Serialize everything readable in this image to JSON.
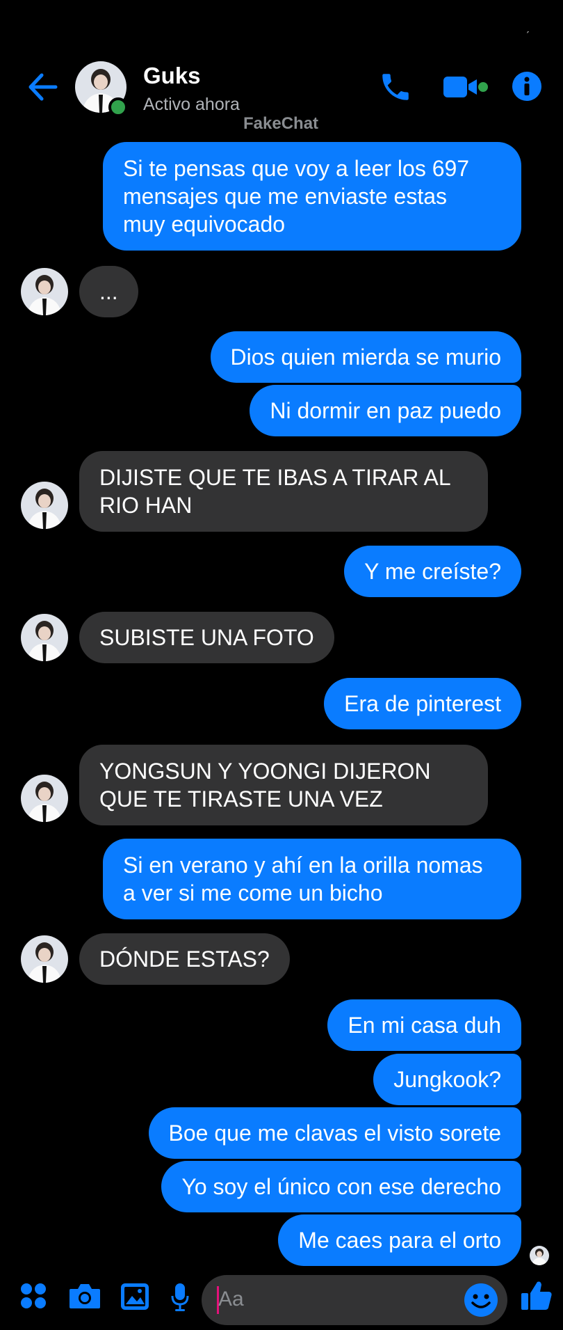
{
  "status_bar": {
    "mark": "ˏ"
  },
  "header": {
    "name": "Guks",
    "status": "Activo ahora",
    "watermark": "FakeChat",
    "accent": "#0a7cff",
    "online_color": "#31a24c"
  },
  "messages": [
    {
      "from": "me",
      "text": "Si te pensas que voy a leer los 697\nmensajes que me enviaste estas\nmuy equivocado"
    },
    {
      "from": "them",
      "text": "..."
    },
    {
      "from": "me",
      "text": "Dios quien mierda se murio"
    },
    {
      "from": "me",
      "text": "Ni dormir en paz puedo"
    },
    {
      "from": "them",
      "text": "DIJISTE QUE TE IBAS A TIRAR AL\nRIO HAN"
    },
    {
      "from": "me",
      "text": "Y me creíste?"
    },
    {
      "from": "them",
      "text": "SUBISTE UNA FOTO"
    },
    {
      "from": "me",
      "text": "Era de pinterest"
    },
    {
      "from": "them",
      "text": "YONGSUN Y YOONGI DIJERON\nQUE TE TIRASTE UNA VEZ"
    },
    {
      "from": "me",
      "text": "Si en verano y ahí en la orilla nomas\na ver si me come un bicho"
    },
    {
      "from": "them",
      "text": "DÓNDE ESTAS?"
    },
    {
      "from": "me",
      "text": "En mi casa duh"
    },
    {
      "from": "me",
      "text": "Jungkook?"
    },
    {
      "from": "me",
      "text": "Boe que me clavas el visto sorete"
    },
    {
      "from": "me",
      "text": "Yo soy el único con ese derecho"
    },
    {
      "from": "me",
      "text": "Me caes para el orto"
    }
  ],
  "composer": {
    "placeholder": "Aa"
  },
  "icons": {
    "header": [
      "back-arrow-icon",
      "phone-icon",
      "video-camera-icon",
      "info-icon"
    ],
    "bottom": [
      "menu-grid-icon",
      "camera-icon",
      "gallery-icon",
      "microphone-icon",
      "emoji-icon",
      "thumbs-up-icon"
    ]
  }
}
